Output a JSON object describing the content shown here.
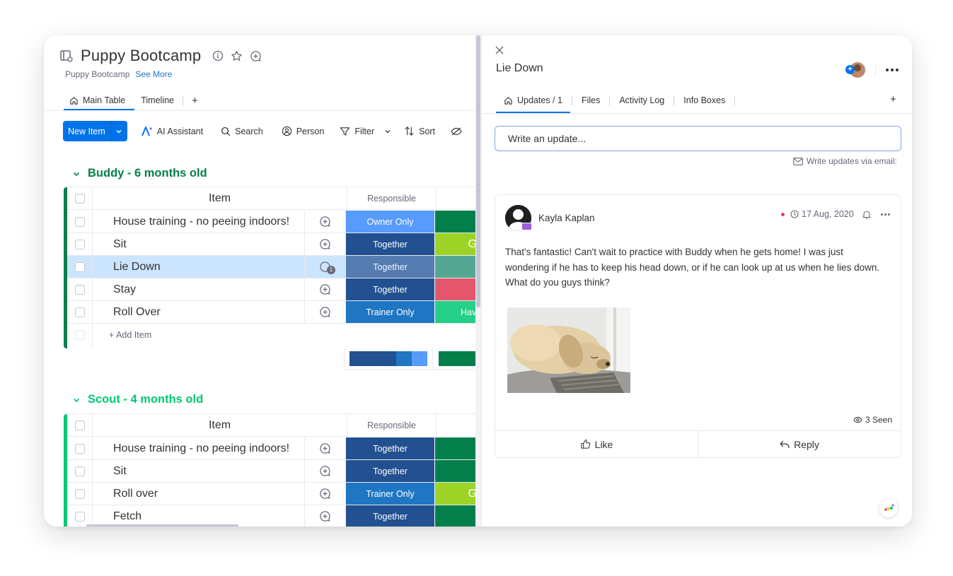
{
  "board": {
    "title": "Puppy Bootcamp",
    "subtitle": "Puppy Bootcamp",
    "see_more": "See More",
    "tabs": [
      {
        "label": "Main Table"
      },
      {
        "label": "Timeline"
      }
    ],
    "add_tab": "+",
    "toolbar": {
      "new_item": "New Item",
      "ai": "AI Assistant",
      "search": "Search",
      "person": "Person",
      "filter": "Filter",
      "sort": "Sort"
    },
    "columns": {
      "item": "Item",
      "responsible": "Responsible"
    },
    "add_item": "+ Add Item",
    "groups": [
      {
        "title": "Buddy - 6 months old",
        "color": "#037f4c",
        "rows": [
          {
            "name": "House training - no peeing indoors!",
            "responsible": "Owner Only",
            "resp_color": "#579bfc",
            "status_text": "",
            "status_color": "#037f4c"
          },
          {
            "name": "Sit",
            "responsible": "Together",
            "resp_color": "#225091",
            "status_text": "G",
            "status_color": "#9cd326"
          },
          {
            "name": "Lie Down",
            "responsible": "Together",
            "resp_color": "#225091",
            "status_text": "",
            "status_color": "#037f4c",
            "updates": "1"
          },
          {
            "name": "Stay",
            "responsible": "Together",
            "resp_color": "#225091",
            "status_text": "",
            "status_color": "#e2445c"
          },
          {
            "name": "Roll Over",
            "responsible": "Trainer Only",
            "resp_color": "#1f76c2",
            "status_text": "Have",
            "status_color": "#00c875"
          }
        ]
      },
      {
        "title": "Scout - 4 months old",
        "color": "#00c875",
        "rows": [
          {
            "name": "House training - no peeing indoors!",
            "responsible": "Together",
            "resp_color": "#225091",
            "status_text": "",
            "status_color": "#037f4c"
          },
          {
            "name": "Sit",
            "responsible": "Together",
            "resp_color": "#225091",
            "status_text": "",
            "status_color": "#037f4c"
          },
          {
            "name": "Roll over",
            "responsible": "Trainer Only",
            "resp_color": "#1f76c2",
            "status_text": "G",
            "status_color": "#9cd326"
          },
          {
            "name": "Fetch",
            "responsible": "Together",
            "resp_color": "#225091",
            "status_text": "",
            "status_color": "#037f4c"
          }
        ]
      }
    ]
  },
  "panel": {
    "item_title": "Lie Down",
    "tabs": [
      {
        "label": "Updates / 1"
      },
      {
        "label": "Files"
      },
      {
        "label": "Activity Log"
      },
      {
        "label": "Info Boxes"
      }
    ],
    "add_tab": "+",
    "write_placeholder": "Write an update...",
    "via_email": "Write updates via email:",
    "update": {
      "author": "Kayla Kaplan",
      "date": "17 Aug, 2020",
      "text": "That's fantastic! Can't wait to practice with Buddy when he gets home! I was just wondering if he has to keep his head down, or if he can look up at us when he lies down. What do you guys think?",
      "seen": "3 Seen",
      "like": "Like",
      "reply": "Reply"
    }
  }
}
